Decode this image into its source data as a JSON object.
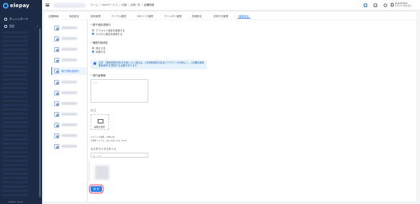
{
  "app": {
    "logo_text": "elepay"
  },
  "sidebar": {
    "dashboard_label": "ダッシュボード",
    "settings_label": "設定",
    "version": "Version 2.0.0"
  },
  "topbar": {
    "breadcrumb": [
      "ホーム",
      "SaaSサービス",
      "店舗",
      "店舗一覧",
      "店舗詳細"
    ],
    "user_name": "ELESTYLE",
    "user_sub": "ELESTYLE株式会社"
  },
  "tabs": [
    "店舗情報",
    "商品設定",
    "端末管理",
    "テーブル管理",
    "QRコード管理",
    "プリンター管理",
    "詳細設定",
    "決済方法管理",
    "機能設定"
  ],
  "active_tab": "機能設定",
  "feature_list": {
    "selected_label": "電子領収書発行"
  },
  "form": {
    "receipt_title": "電子領収書発行",
    "receipt_options": [
      "デフォルト設定を使用する",
      "カスタム設定を使用する"
    ],
    "usage_title": "機能利用設定",
    "usage_options": [
      "停止する",
      "利用する"
    ],
    "info_text": "注意：[基幹税務計算]を利用したい場合は、[決済明細表示設定]プラグインを有効にし、[店舗情報事業者番号]を登録する必要があります。",
    "issuer_title": "発行者情報",
    "issuer_placeholder": "入力",
    "logo_title": "ロゴ",
    "upload_label": "画像を選択",
    "hint_size": "※ファイル容量：1MB以内",
    "hint_format": "※対象ファイル：jpg, jpeg, png, webp",
    "css_title": "カスタマイズスタイル",
    "css_placeholder": "例：CSS",
    "save_label": "保 存"
  }
}
